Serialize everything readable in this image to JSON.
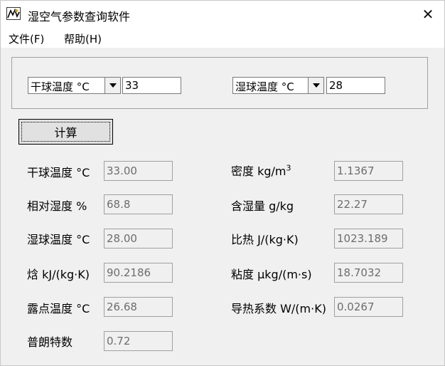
{
  "window": {
    "title": "湿空气参数查询软件",
    "close_glyph": "✕"
  },
  "menu": {
    "file": "文件(F)",
    "help": "帮助(H)"
  },
  "input": {
    "param1_selected": "干球温度 °C",
    "param1_value": "33",
    "param2_selected": "湿球温度 °C",
    "param2_value": "28"
  },
  "calc_button": "计算",
  "results": {
    "dry_bulb": {
      "label": "干球温度 °C",
      "value": "33.00"
    },
    "relative_humidity": {
      "label": "相对湿度 %",
      "value": "68.8"
    },
    "wet_bulb": {
      "label": "湿球温度 °C",
      "value": "28.00"
    },
    "enthalpy": {
      "label": "焓 kJ/(kg·K)",
      "value": "90.2186"
    },
    "dew_point": {
      "label": "露点温度 °C",
      "value": "26.68"
    },
    "prandtl": {
      "label": "普朗特数",
      "value": "0.72"
    },
    "density": {
      "label": "密度 kg/m",
      "label_sup": "3",
      "value": "1.1367"
    },
    "moisture_content": {
      "label": "含湿量 g/kg",
      "value": "22.27"
    },
    "specific_heat": {
      "label": "比热 J/(kg·K)",
      "value": "1023.189"
    },
    "viscosity": {
      "label": "粘度 μkg/(m·s)",
      "value": "18.7032"
    },
    "thermal_conductivity": {
      "label": "导热系数 W/(m·K)",
      "value": "0.0267"
    }
  },
  "icons": {
    "app": "app-icon",
    "close": "close-icon",
    "dropdown": "chevron-down-icon"
  }
}
